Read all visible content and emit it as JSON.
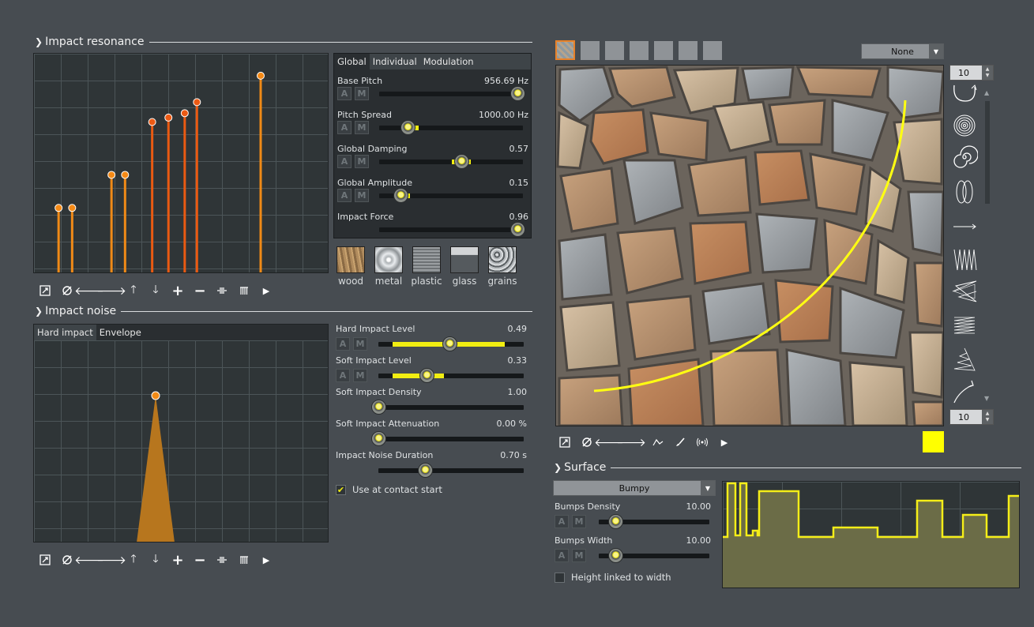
{
  "impact_resonance": {
    "title": "Impact resonance",
    "tabs": [
      "Global",
      "Individual",
      "Modulation"
    ],
    "params": [
      {
        "label": "Base Pitch",
        "value": "956.69 Hz",
        "level": 0.96,
        "auto": true
      },
      {
        "label": "Pitch Spread",
        "value": "1000.00 Hz",
        "level": 0.2,
        "auto": true
      },
      {
        "label": "Global Damping",
        "value": "0.57",
        "level": 0.57,
        "auto": false
      },
      {
        "label": "Global Amplitude",
        "value": "0.15",
        "level": 0.15,
        "auto": true
      },
      {
        "label": "Impact Force",
        "value": "0.96",
        "level": 0.96,
        "auto": false
      }
    ],
    "am_labels": [
      "A",
      "M"
    ],
    "materials": [
      "wood",
      "metal",
      "plastic",
      "glass",
      "grains"
    ],
    "partials": [
      {
        "x": 1.5,
        "amp": 0.3
      },
      {
        "x": 2.0,
        "amp": 0.3
      },
      {
        "x": 3.45,
        "amp": 0.45
      },
      {
        "x": 3.95,
        "amp": 0.45
      },
      {
        "x": 4.95,
        "amp": 0.69
      },
      {
        "x": 5.55,
        "amp": 0.71
      },
      {
        "x": 6.15,
        "amp": 0.73
      },
      {
        "x": 6.6,
        "amp": 0.78
      },
      {
        "x": 8.95,
        "amp": 0.9
      }
    ]
  },
  "impact_noise": {
    "title": "Impact noise",
    "tabs": [
      "Hard impact",
      "Envelope"
    ],
    "params": [
      {
        "label": "Hard Impact Level",
        "value": "0.49",
        "level": 0.49,
        "fill": [
          0.1,
          0.87
        ]
      },
      {
        "label": "Soft Impact Level",
        "value": "0.33",
        "level": 0.33,
        "fill": [
          0.1,
          0.45
        ]
      },
      {
        "label": "Soft Impact Density",
        "value": "1.00",
        "level": 0.0
      },
      {
        "label": "Soft Impact Attenuation",
        "value": "0.00 %",
        "level": 0.0
      },
      {
        "label": "Impact Noise Duration",
        "value": "0.70 s",
        "level": 0.32
      }
    ],
    "checkbox_label": "Use at contact start",
    "checkbox_checked": true
  },
  "texture": {
    "combo_value": "None",
    "spin_top": "10",
    "spin_bottom": "10",
    "stroke_icons": [
      "arc-stroke-icon",
      "circle-spiral-icon",
      "spiral-icon",
      "loops-icon",
      "line-stroke-icon",
      "zigzag-block-icon",
      "zigzag-taper-icon",
      "scribble-icon",
      "tree-zigzag-icon",
      "curve-arrow-icon"
    ],
    "color_swatch": "#ffff00"
  },
  "surface": {
    "title": "Surface",
    "mode": "Bumpy",
    "params": [
      {
        "label": "Bumps Density",
        "value": "10.00",
        "level": 0.1
      },
      {
        "label": "Bumps Width",
        "value": "10.00",
        "level": 0.1
      }
    ],
    "checkbox_label": "Height linked to width",
    "checkbox_checked": false
  },
  "colors": {
    "accent": "#f2ee12",
    "partial": "#f07a12",
    "panel_bg": "#2a2e31",
    "app_bg": "#474c51"
  }
}
